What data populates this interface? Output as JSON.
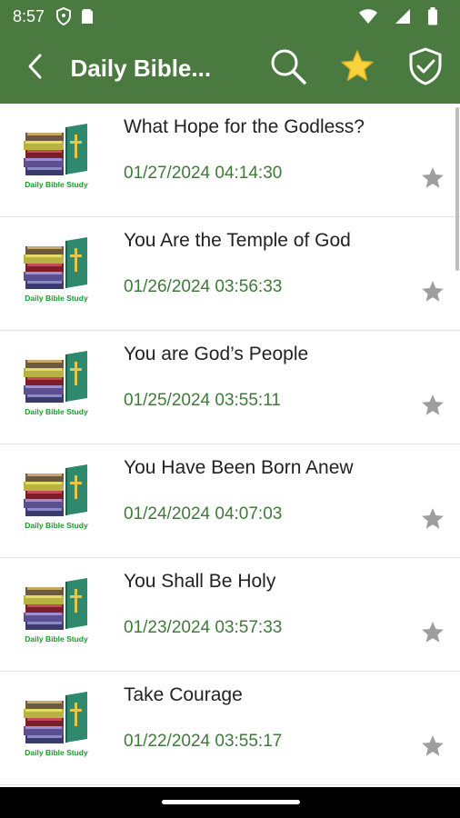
{
  "status_bar": {
    "time": "8:57",
    "icons": [
      "shield-icon",
      "sim-card-icon",
      "wifi-icon",
      "signal-icon",
      "battery-icon"
    ]
  },
  "app_bar": {
    "title": "Daily Bible...",
    "back_icon": "back-arrow-icon",
    "actions": [
      "search-icon",
      "favorite-star-icon",
      "verified-shield-icon"
    ],
    "background": "#4a7a3f"
  },
  "thumbnail_caption": "Daily Bible Study",
  "items": [
    {
      "title": "What Hope for the Godless?",
      "date": "01/27/2024 04:14:30"
    },
    {
      "title": "You Are the Temple of God",
      "date": "01/26/2024 03:56:33"
    },
    {
      "title": "You are God’s People",
      "date": "01/25/2024 03:55:11"
    },
    {
      "title": "You Have Been Born Anew",
      "date": "01/24/2024 04:07:03"
    },
    {
      "title": "You Shall Be Holy",
      "date": "01/23/2024 03:57:33"
    },
    {
      "title": "Take Courage",
      "date": "01/22/2024 03:55:17"
    }
  ],
  "colors": {
    "primary": "#4a7a3f",
    "date_text": "#3f7a3a",
    "star_gray": "#9e9e9e",
    "star_gold": "#f6d33a"
  }
}
